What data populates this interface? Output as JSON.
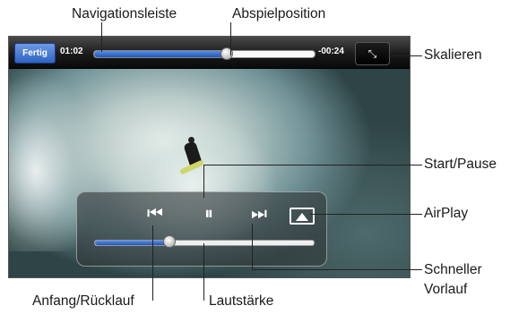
{
  "callouts": {
    "navigation_bar": "Navigationsleiste",
    "playhead": "Abspielposition",
    "scale": "Skalieren",
    "play_pause": "Start/Pause",
    "airplay": "AirPlay",
    "fast_forward_line1": "Schneller",
    "fast_forward_line2": "Vorlauf",
    "rewind": "Anfang/Rücklauf",
    "volume": "Lautstärke"
  },
  "player": {
    "done_label": "Fertig",
    "elapsed": "01:02",
    "remaining": "-00:24",
    "progress_fraction": 0.6,
    "volume_fraction": 0.34,
    "icons": {
      "scale": "scale-arrows-icon",
      "rewind": "skip-back-icon",
      "pause": "pause-icon",
      "forward": "skip-forward-icon",
      "airplay": "airplay-icon"
    },
    "glyphs": {
      "scale": "⤡",
      "rewind": "⏮",
      "pause": "⏸",
      "forward": "⏭"
    }
  },
  "colors": {
    "accent_blue": "#2f63c4",
    "bar_dark": "#1a1a1a"
  }
}
